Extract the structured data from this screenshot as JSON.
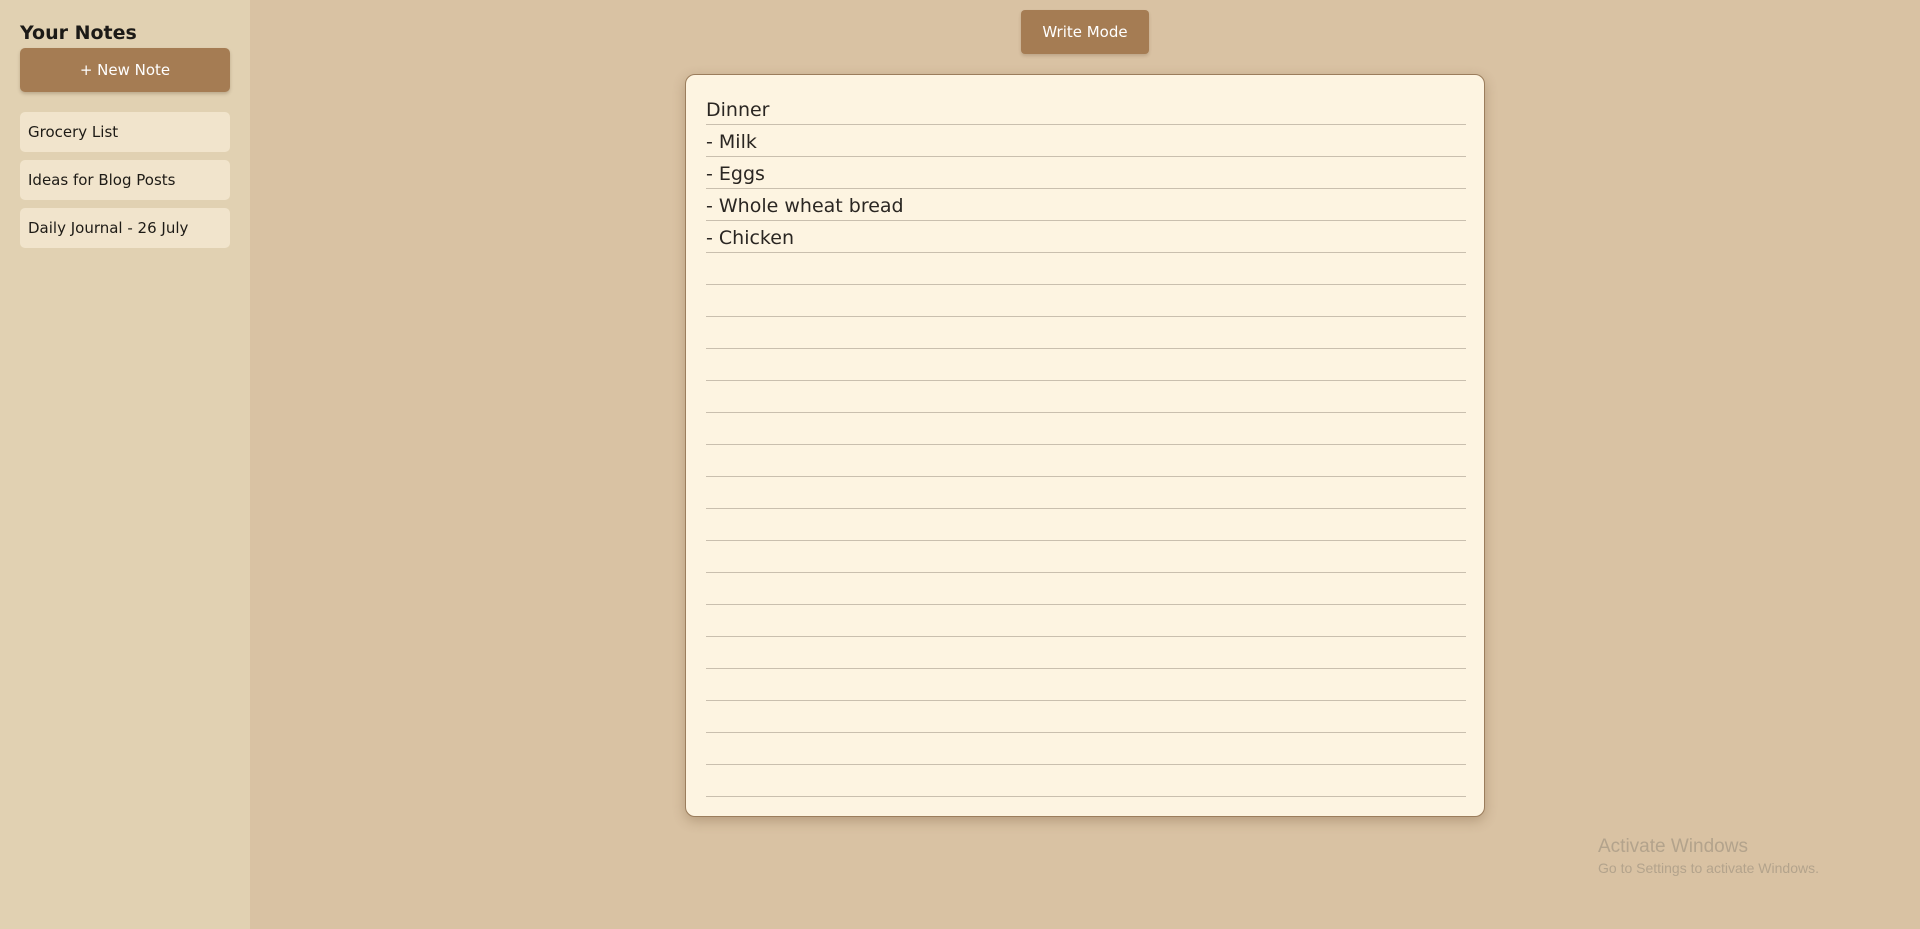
{
  "sidebar": {
    "title": "Your Notes",
    "new_note_label": "+ New Note",
    "notes": [
      {
        "title": "Grocery List"
      },
      {
        "title": "Ideas for Blog Posts"
      },
      {
        "title": "Daily Journal - 26 July"
      }
    ]
  },
  "toolbar": {
    "mode_label": "Write Mode"
  },
  "editor": {
    "lines": [
      "Dinner",
      "- Milk",
      "- Eggs",
      "- Whole wheat bread",
      "- Chicken",
      "",
      "",
      "",
      "",
      "",
      "",
      "",
      "",
      "",
      "",
      "",
      "",
      "",
      "",
      "",
      "",
      ""
    ]
  },
  "watermark": {
    "title": "Activate Windows",
    "subtitle": "Go to Settings to activate Windows."
  }
}
